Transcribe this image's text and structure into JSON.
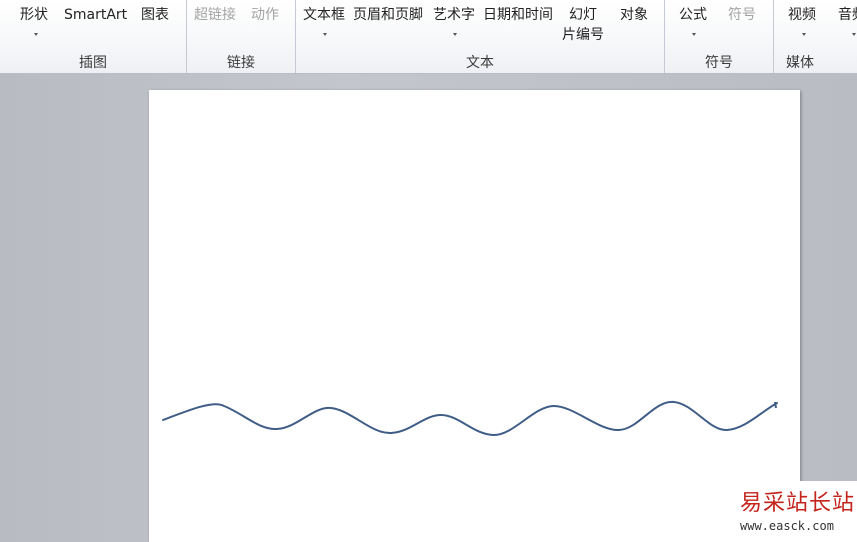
{
  "ribbon": {
    "groups": {
      "illustrations": {
        "label": "插图",
        "shapes": "形状",
        "smartart": "SmartArt",
        "chart": "图表"
      },
      "links": {
        "label": "链接",
        "hyperlink": "超链接",
        "action": "动作"
      },
      "text": {
        "label": "文本",
        "textbox": "文本框",
        "header_footer": "页眉和页脚",
        "wordart": "艺术字",
        "date_time": "日期和时间",
        "slide_number_line1": "幻灯",
        "slide_number_line2": "片编号",
        "object": "对象"
      },
      "symbols": {
        "label": "符号",
        "equation": "公式",
        "symbol": "符号"
      },
      "media": {
        "label": "媒体",
        "video": "视频",
        "audio": "音频"
      }
    }
  },
  "slide": {
    "wave_color": "#3f5d86"
  },
  "watermark": {
    "site_name": "易采站长站",
    "url": "www.easck.com"
  }
}
